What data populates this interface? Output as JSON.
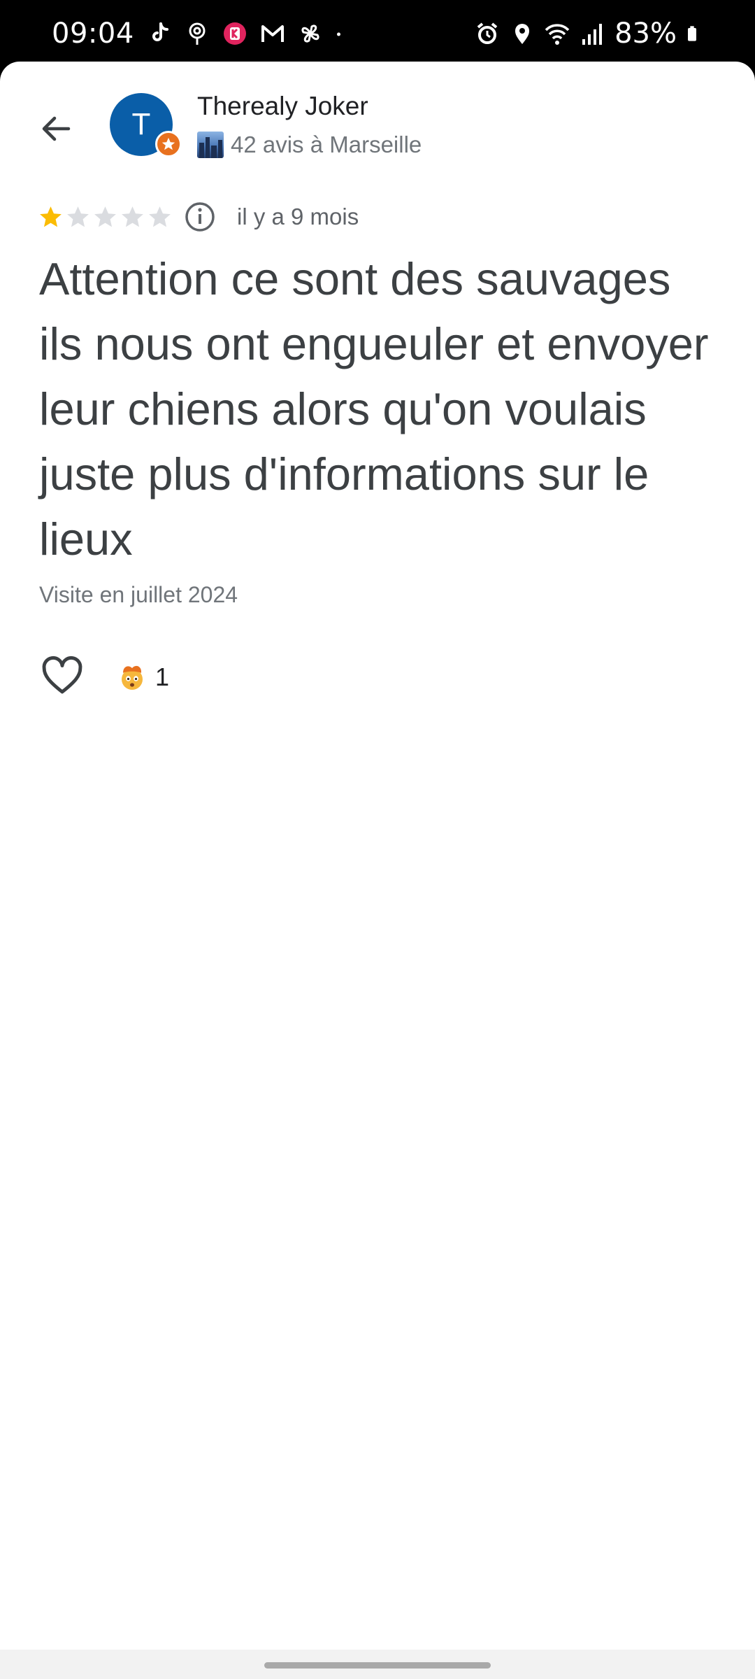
{
  "status_bar": {
    "time": "09:04",
    "battery": "83%",
    "left_icons": [
      "tiktok-icon",
      "location-pin-icon",
      "kinemaster-icon",
      "gmail-icon",
      "pinwheel-icon",
      "dot-icon"
    ],
    "right_icons": [
      "alarm-icon",
      "location-icon",
      "wifi-icon",
      "signal-icon",
      "battery-icon"
    ]
  },
  "header": {
    "back_icon": "arrow-back-icon",
    "avatar_letter": "T",
    "avatar_color": "#0a5ea8",
    "badge_color": "#e8711f",
    "user_name": "Therealy Joker",
    "user_meta": "42 avis à Marseille"
  },
  "review": {
    "rating": 1,
    "max_rating": 5,
    "time_ago": "il y a 9 mois",
    "text": "Attention ce sont des sauvages ils nous ont engueuler et envoyer leur chiens alors qu'on voulais juste plus d'informations sur le lieux",
    "visit": "Visite en juillet 2024"
  },
  "reactions": {
    "like_icon": "heart-outline-icon",
    "emoji_icon": "exploding-head-emoji",
    "count": "1"
  },
  "colors": {
    "star_filled": "#fbbc04",
    "star_empty": "#dadce0",
    "text_primary": "#3c4043",
    "text_secondary": "#70757a"
  }
}
